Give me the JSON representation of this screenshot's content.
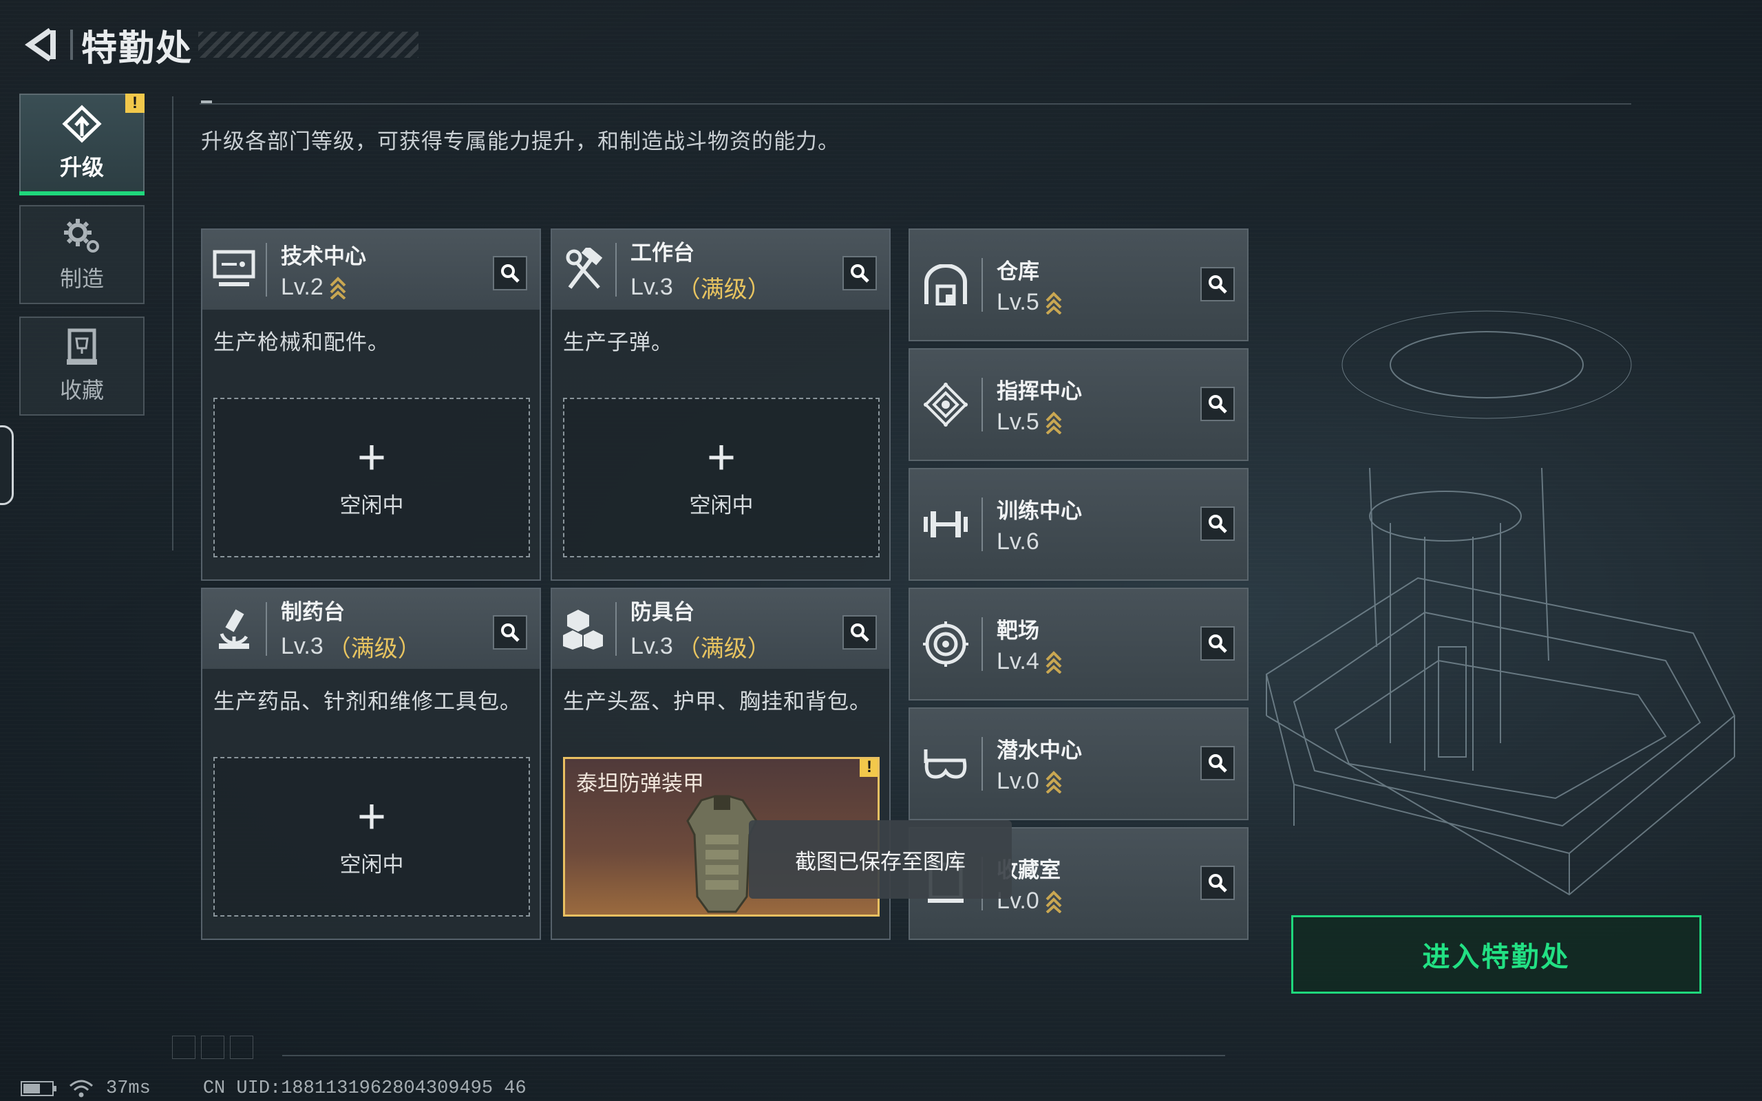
{
  "header": {
    "title": "特勤处"
  },
  "nav": [
    {
      "id": "upgrade",
      "label": "升级",
      "icon": "upgrade-icon",
      "active": true,
      "alert": "!"
    },
    {
      "id": "craft",
      "label": "制造",
      "icon": "gear-icon",
      "active": false
    },
    {
      "id": "collection",
      "label": "收藏",
      "icon": "trophy-icon",
      "active": false
    }
  ],
  "subtitle": "升级各部门等级，可获得专属能力提升，和制造战斗物资的能力。",
  "facilities": [
    {
      "name": "技术中心",
      "level": "Lv.2",
      "maxed": "",
      "desc": "生产枪械和配件。",
      "slot": {
        "type": "idle",
        "text": "空闲中"
      }
    },
    {
      "name": "工作台",
      "level": "Lv.3",
      "maxed": "（满级）",
      "desc": "生产子弹。",
      "slot": {
        "type": "idle",
        "text": "空闲中"
      }
    },
    {
      "name": "制药台",
      "level": "Lv.3",
      "maxed": "（满级）",
      "desc": "生产药品、针剂和维修工具包。",
      "slot": {
        "type": "idle",
        "text": "空闲中"
      }
    },
    {
      "name": "防具台",
      "level": "Lv.3",
      "maxed": "（满级）",
      "desc": "生产头盔、护甲、胸挂和背包。",
      "slot": {
        "type": "item",
        "text": "泰坦防弹装甲",
        "alert": "!"
      }
    }
  ],
  "rooms": [
    {
      "name": "仓库",
      "level": "Lv.5",
      "icon": "warehouse-icon"
    },
    {
      "name": "指挥中心",
      "level": "Lv.5",
      "icon": "command-icon"
    },
    {
      "name": "训练中心",
      "level": "Lv.6",
      "icon": "dumbbell-icon"
    },
    {
      "name": "靶场",
      "level": "Lv.4",
      "icon": "target-icon"
    },
    {
      "name": "潜水中心",
      "level": "Lv.0",
      "icon": "diving-mask-icon"
    },
    {
      "name": "收藏室",
      "level": "Lv.0",
      "icon": "display-case-icon"
    }
  ],
  "idle_plus": "+",
  "enter_button": "进入特勤处",
  "toast": "截图已保存至图库",
  "status": {
    "latency": "37ms",
    "uid": "CN UID:1881131962804309495 46"
  },
  "colors": {
    "accent": "#1fd77c",
    "gold": "#e8c460",
    "alert": "#f2c84b"
  }
}
